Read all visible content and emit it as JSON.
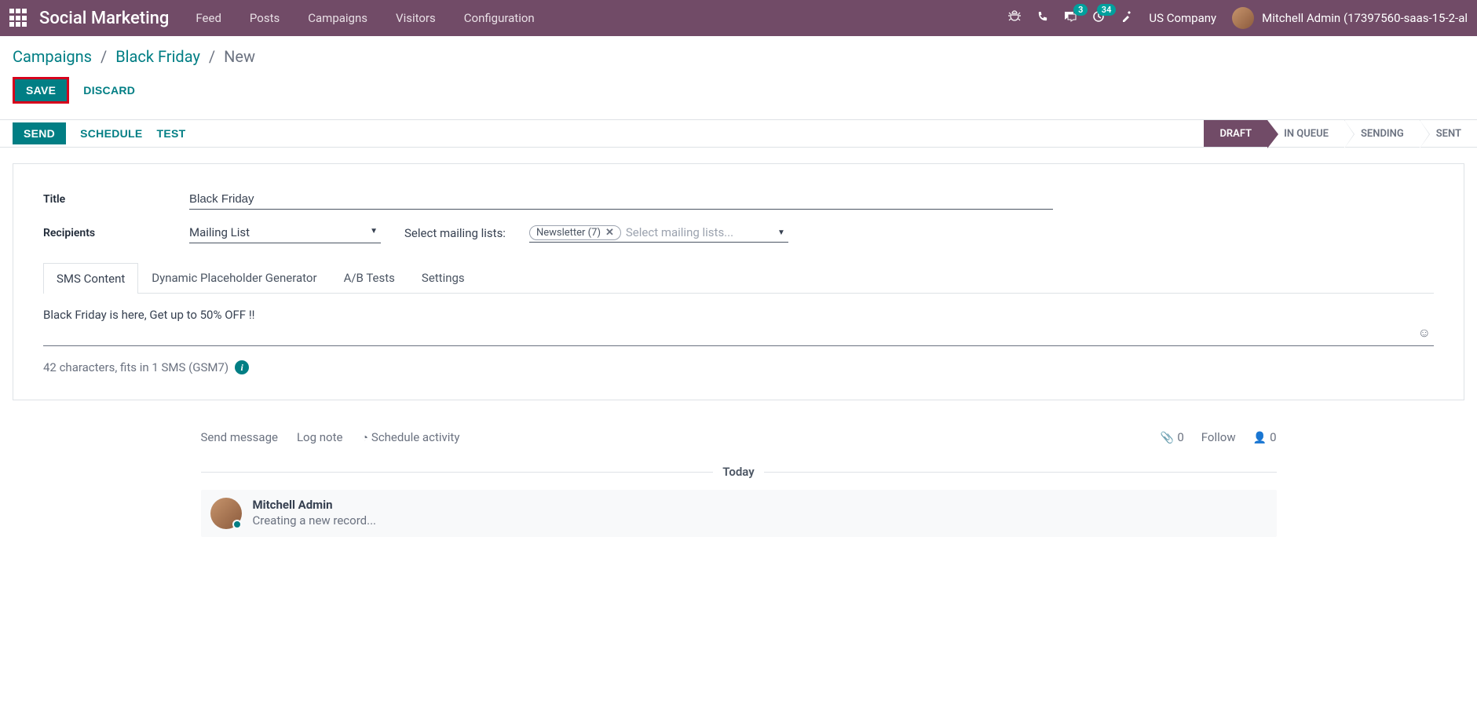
{
  "nav": {
    "brand": "Social Marketing",
    "links": [
      "Feed",
      "Posts",
      "Campaigns",
      "Visitors",
      "Configuration"
    ],
    "msg_badge": "3",
    "act_badge": "34",
    "company": "US Company",
    "user": "Mitchell Admin (17397560-saas-15-2-al"
  },
  "breadcrumb": {
    "root": "Campaigns",
    "parent": "Black Friday",
    "current": "New"
  },
  "actions": {
    "save": "SAVE",
    "discard": "DISCARD"
  },
  "statusbar": {
    "send": "SEND",
    "schedule": "SCHEDULE",
    "test": "TEST",
    "stages": [
      "DRAFT",
      "IN QUEUE",
      "SENDING",
      "SENT"
    ],
    "active_stage": 0
  },
  "form": {
    "title_label": "Title",
    "title_value": "Black Friday",
    "recipients_label": "Recipients",
    "recipients_value": "Mailing List",
    "ml_label": "Select mailing lists:",
    "ml_tag": "Newsletter (7)",
    "ml_placeholder": "Select mailing lists..."
  },
  "tabs": [
    "SMS Content",
    "Dynamic Placeholder Generator",
    "A/B Tests",
    "Settings"
  ],
  "sms": {
    "body": "Black Friday is here, Get up to 50% OFF !!",
    "info": "42 characters, fits in 1 SMS (GSM7)"
  },
  "chatter": {
    "send_msg": "Send message",
    "log_note": "Log note",
    "schedule_activity": "Schedule activity",
    "attach_count": "0",
    "follow": "Follow",
    "follower_count": "0",
    "divider": "Today",
    "msg_author": "Mitchell Admin",
    "msg_body": "Creating a new record..."
  }
}
